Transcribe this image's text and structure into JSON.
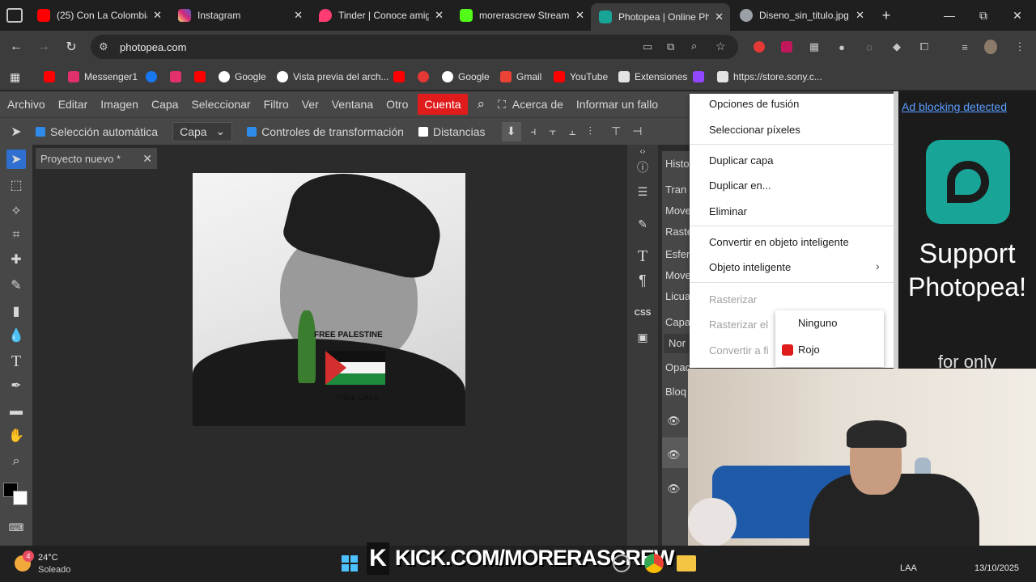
{
  "browser": {
    "tabs": [
      {
        "title": "(25) Con La Colombia",
        "icon": "youtube-icon",
        "color": "#ff0000"
      },
      {
        "title": "Instagram",
        "icon": "instagram-icon",
        "color": "#e1306c"
      },
      {
        "title": "Tinder | Conoce amig",
        "icon": "tinder-icon",
        "color": "#fe3c72"
      },
      {
        "title": "morerascrew Stream",
        "icon": "kick-icon",
        "color": "#53fc18"
      },
      {
        "title": "Photopea | Online Ph",
        "icon": "photopea-icon",
        "color": "#18a497"
      },
      {
        "title": "Diseno_sin_titulo.jpg",
        "icon": "globe-icon",
        "color": "#9aa0a6"
      }
    ],
    "new_tab": "+",
    "window": {
      "minimize": "—",
      "maximize": "⧉",
      "close": "✕"
    },
    "url": "photopea.com",
    "bookmarks": [
      {
        "label": "",
        "icon": "youtube-icon",
        "color": "#ff0000"
      },
      {
        "label": "Messenger1",
        "icon": "instagram-icon",
        "color": "#e1306c"
      },
      {
        "label": "",
        "icon": "facebook-icon",
        "color": "#1877f2"
      },
      {
        "label": "",
        "icon": "instagram-icon",
        "color": "#e1306c"
      },
      {
        "label": "",
        "icon": "youtube-icon",
        "color": "#ff0000"
      },
      {
        "label": "Google",
        "icon": "google-icon",
        "color": "#ffffff"
      },
      {
        "label": "Vista previa del arch...",
        "icon": "globe-icon",
        "color": "#ffffff"
      },
      {
        "label": "",
        "icon": "youtube-icon",
        "color": "#ff0000"
      },
      {
        "label": "",
        "icon": "app-icon",
        "color": "#e53935"
      },
      {
        "label": "Google",
        "icon": "google-icon",
        "color": "#ffffff"
      },
      {
        "label": "Gmail",
        "icon": "gmail-icon",
        "color": "#ea4335"
      },
      {
        "label": "YouTube",
        "icon": "youtube-icon",
        "color": "#ff0000"
      },
      {
        "label": "Extensiones",
        "icon": "puzzle-icon",
        "color": "#e3e3e3"
      },
      {
        "label": "",
        "icon": "twitch-icon",
        "color": "#9146ff"
      },
      {
        "label": "https://store.sony.c...",
        "icon": "sony-icon",
        "color": "#e3e3e3"
      }
    ]
  },
  "photopea": {
    "menu": [
      "Archivo",
      "Editar",
      "Imagen",
      "Capa",
      "Seleccionar",
      "Filtro",
      "Ver",
      "Ventana",
      "Otro",
      "Cuenta"
    ],
    "menu_extra": [
      "Acerca de",
      "Informar un fallo"
    ],
    "options": {
      "auto_select": "Selección automática",
      "auto_select_target": "Capa",
      "transform_controls": "Controles de transformación",
      "distances": "Distancias"
    },
    "document_tab": "Proyecto nuevo *",
    "canvas_text": {
      "top": "FREE PALESTINE",
      "bottom": "FREE GAZA"
    },
    "panel_items": [
      "Histo",
      "Tran",
      "Move",
      "Raste",
      "Esfer",
      "Move",
      "Licua",
      "Capa",
      "Nor",
      "Opac",
      "Bloq"
    ],
    "context_menu": [
      {
        "label": "Opciones de fusión",
        "disabled": false
      },
      {
        "label": "Seleccionar píxeles",
        "disabled": false
      },
      {
        "label": "Duplicar capa",
        "disabled": false
      },
      {
        "label": "Duplicar en...",
        "disabled": false
      },
      {
        "label": "Eliminar",
        "disabled": false
      },
      {
        "label": "Convertir en objeto inteligente",
        "disabled": false
      },
      {
        "label": "Objeto inteligente",
        "disabled": false
      },
      {
        "label": "Rasterizar",
        "disabled": true
      },
      {
        "label": "Rasterizar el",
        "disabled": true
      },
      {
        "label": "Convertir a fi",
        "disabled": true
      }
    ],
    "color_submenu": [
      {
        "label": "Ninguno",
        "color": ""
      },
      {
        "label": "Rojo",
        "color": "#e01b1b"
      }
    ]
  },
  "ad": {
    "notice": "Ad blocking detected",
    "line1": "Support",
    "line2": "Photopea!",
    "line3": "for only"
  },
  "stream_overlay": "KICK.COM/MORERASCREW",
  "taskbar": {
    "weather_temp": "24°C",
    "weather_desc": "Soleado",
    "weather_badge": "4",
    "lang": "LAA",
    "date": "13/10/2025"
  }
}
